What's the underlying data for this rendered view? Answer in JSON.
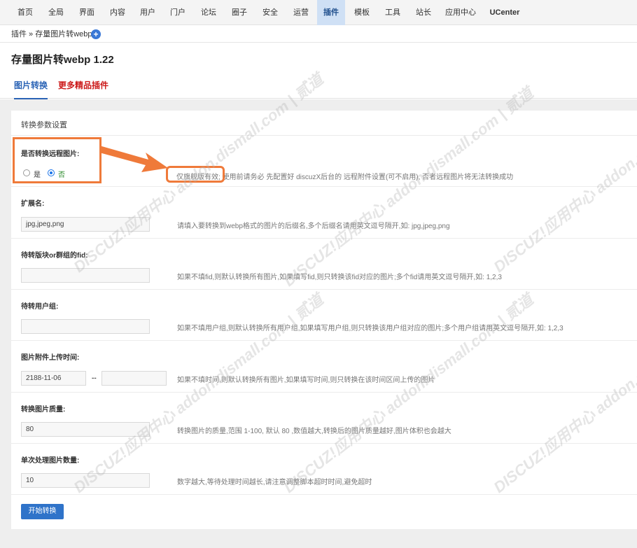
{
  "nav": {
    "items": [
      "首页",
      "全局",
      "界面",
      "内容",
      "用户",
      "门户",
      "论坛",
      "圈子",
      "安全",
      "运营",
      "插件",
      "模板",
      "工具",
      "站长",
      "应用中心",
      "UCenter"
    ],
    "active": "插件"
  },
  "breadcrumb": "插件 » 存量图片转webp",
  "page_title": "存量图片转webp 1.22",
  "tabs": {
    "convert": "图片转换",
    "more": "更多精品插件"
  },
  "panel_title": "转换参数设置",
  "remote": {
    "label": "是否转换远程图片:",
    "opt_yes": "是",
    "opt_no": "否",
    "selected": "否",
    "hint": "仅旗舰版有效; 使用前请务必 先配置好 discuzX后台的 远程附件设置(可不启用), 否者远程图片将无法转换成功"
  },
  "ext": {
    "label": "扩展名:",
    "value": "jpg,jpeg,png",
    "hint": "请填入要转换到webp格式的图片的后缀名,多个后缀名请用英文逗号隔开,如: jpg,jpeg,png"
  },
  "fid": {
    "label": "待转版块or群组的fid:",
    "value": "",
    "hint": "如果不填fid,则默认转换所有图片,如果填写fid,则只转换该fid对应的图片;多个fid请用英文逗号隔开,如: 1,2,3"
  },
  "group": {
    "label": "待转用户组:",
    "value": "",
    "hint": "如果不填用户组,则默认转换所有用户组,如果填写用户组,则只转换该用户组对应的图片;多个用户组请用英文逗号隔开,如: 1,2,3"
  },
  "time": {
    "label": "图片附件上传时间:",
    "from": "2188-11-06",
    "sep": "--",
    "to": "",
    "hint": "如果不填时间,则默认转换所有图片,如果填写时间,则只转换在该时间区间上传的图片"
  },
  "quality": {
    "label": "转换图片质量:",
    "value": "80",
    "hint": "转换图片的质量,范围 1-100, 默认 80 ,数值越大,转换后的图片质量越好,图片体积也会越大"
  },
  "count": {
    "label": "单次处理图片数量:",
    "value": "10",
    "hint": "数字越大,等待处理时间越长,请注意调整脚本超时时间,避免超时"
  },
  "start_button": "开始转换",
  "watermark": "DISCUZ!应用中心 addon.dismall.com | 贰道",
  "colors": {
    "accent": "#2f73c9",
    "annotation": "#ef7a3a",
    "red_tab": "#cc1a1a"
  }
}
